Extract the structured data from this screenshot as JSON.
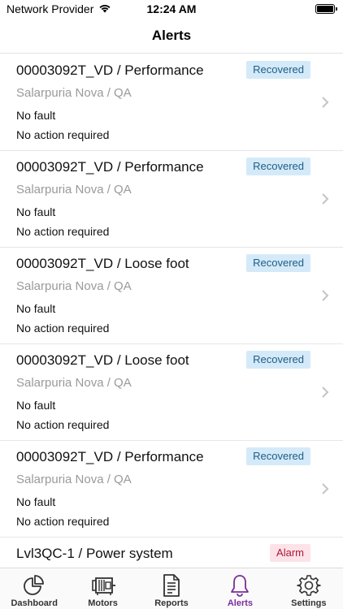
{
  "status_bar": {
    "carrier": "Network Provider",
    "time": "12:24 AM"
  },
  "header": {
    "title": "Alerts"
  },
  "alerts": [
    {
      "title": "00003092T_VD / Performance",
      "status": "Recovered",
      "status_type": "recovered",
      "location": "Salarpuria Nova / QA",
      "fault": "No fault",
      "action": "No action required"
    },
    {
      "title": "00003092T_VD / Performance",
      "status": "Recovered",
      "status_type": "recovered",
      "location": "Salarpuria Nova / QA",
      "fault": "No fault",
      "action": "No action required"
    },
    {
      "title": "00003092T_VD / Loose foot",
      "status": "Recovered",
      "status_type": "recovered",
      "location": "Salarpuria Nova / QA",
      "fault": "No fault",
      "action": "No action required"
    },
    {
      "title": "00003092T_VD / Loose foot",
      "status": "Recovered",
      "status_type": "recovered",
      "location": "Salarpuria Nova / QA",
      "fault": "No fault",
      "action": "No action required"
    },
    {
      "title": "00003092T_VD / Performance",
      "status": "Recovered",
      "status_type": "recovered",
      "location": "Salarpuria Nova / QA",
      "fault": "No fault",
      "action": "No action required"
    },
    {
      "title": "Lvl3QC-1 / Power system",
      "status": "Alarm",
      "status_type": "alarm",
      "location": "",
      "fault": "",
      "action": ""
    }
  ],
  "tabs": [
    {
      "label": "Dashboard",
      "icon": "pie-chart-icon",
      "active": false
    },
    {
      "label": "Motors",
      "icon": "motor-icon",
      "active": false
    },
    {
      "label": "Reports",
      "icon": "document-icon",
      "active": false
    },
    {
      "label": "Alerts",
      "icon": "bell-icon",
      "active": true
    },
    {
      "label": "Settings",
      "icon": "gear-icon",
      "active": false
    }
  ],
  "colors": {
    "accent": "#7b2d99",
    "recovered_bg": "#d4eaf8",
    "recovered_text": "#1f5c87",
    "alarm_bg": "#fde3e8",
    "alarm_text": "#b0163a"
  }
}
